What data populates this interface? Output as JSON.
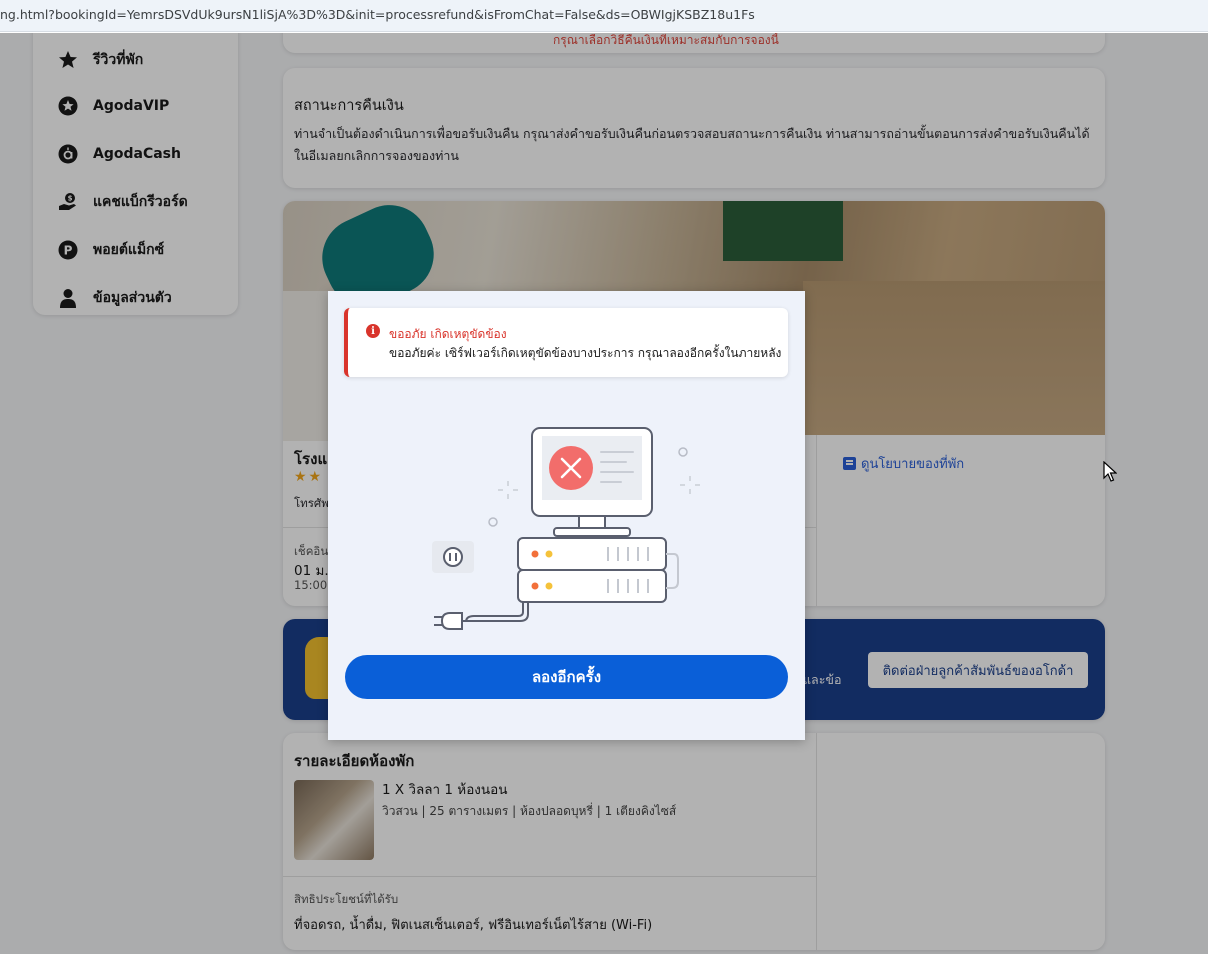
{
  "browser": {
    "url": "ng.html?bookingId=YemrsDSVdUk9ursN1liSjA%3D%3D&init=processrefund&isFromChat=False&ds=OBWIgjKSBZ18u1Fs"
  },
  "sidebar": {
    "items": [
      {
        "label": "รีวิวที่พัก",
        "icon": "star-icon"
      },
      {
        "label": "AgodaVIP",
        "icon": "vip-star-icon"
      },
      {
        "label": "AgodaCash",
        "icon": "agodacash-icon"
      },
      {
        "label": "แคชแบ็กรีวอร์ด",
        "icon": "cashback-hand-icon"
      },
      {
        "label": "พอยต์แม็กซ์",
        "icon": "pointsmax-icon"
      },
      {
        "label": "ข้อมูลส่วนตัว",
        "icon": "user-icon"
      }
    ]
  },
  "top_card": {
    "note": "กรุณาเลือกวิธีคืนเงินที่เหมาะสมกับการจองนี้"
  },
  "refund_status": {
    "title": "สถานะการคืนเงิน",
    "body": "ท่านจำเป็นต้องดำเนินการเพื่อขอรับเงินคืน กรุณาส่งคำขอรับเงินคืนก่อนตรวจสอบสถานะการคืนเงิน ท่านสามารถอ่านขั้นตอนการส่งคำขอรับเงินคืนได้ในอีเมลยกเลิกการจองของท่าน"
  },
  "hotel": {
    "name": "โรงแ",
    "stars": "★★",
    "phone": "โทรศัพ",
    "checkin_label": "เช็คอิน",
    "checkin_date": "01 ม.",
    "checkin_time": "15:00",
    "policy_link": "ดูนโยบายของที่พัก"
  },
  "banner": {
    "text": "และข้อ",
    "button": "ติดต่อฝ่ายลูกค้าสัมพันธ์ของอโกด้า"
  },
  "room": {
    "section_title": "รายละเอียดห้องพัก",
    "title": "1 X วิลลา 1 ห้องนอน",
    "features": "วิวสวน | 25 ตารางเมตร | ห้องปลอดบุหรี่ | 1 เตียงคิงไซส์",
    "benefits_label": "สิทธิประโยชน์ที่ได้รับ",
    "benefits": "ที่จอดรถ, น้ำดื่ม, ฟิตเนสเซ็นเตอร์, ฟรีอินเทอร์เน็ตไร้สาย (Wi-Fi)"
  },
  "modal": {
    "alert_title": "ขออภัย เกิดเหตุขัดข้อง",
    "alert_message": "ขออภัยค่ะ เซิร์ฟเวอร์เกิดเหตุขัดข้องบางประการ กรุณาลองอีกครั้งในภายหลัง",
    "alert_icon": "error-info-icon",
    "illustration": "server-error-illustration",
    "retry_button": "ลองอีกครั้ง",
    "colors": {
      "error": "#d9342b",
      "primary": "#0a5fd8",
      "background": "#eef2fa"
    }
  }
}
